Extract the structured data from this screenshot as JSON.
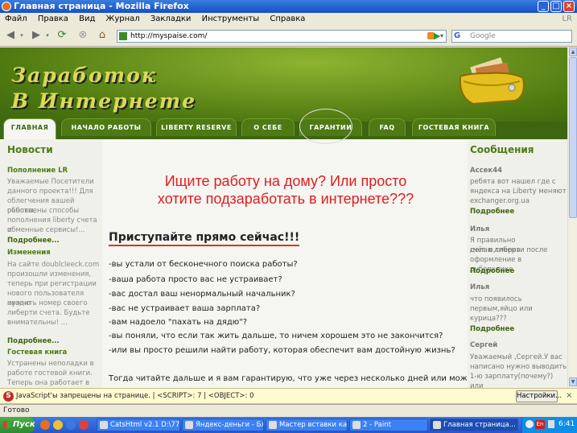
{
  "window": {
    "title": "Главная страница - Mozilla Firefox"
  },
  "menu": [
    "Файл",
    "Правка",
    "Вид",
    "Журнал",
    "Закладки",
    "Инструменты",
    "Справка"
  ],
  "menu_right": "LR",
  "toolbar": {
    "url": "http://myspaise.com/",
    "search_engine": "G",
    "search_placeholder": "Google"
  },
  "site": {
    "logo_line1": "Заработок",
    "logo_line2": "В Интернете",
    "tabs": [
      "ГЛАВНАЯ",
      "НАЧАЛО РАБОТЫ",
      "LIBERTY RESERVE",
      "О СЕБЕ",
      "ГАРАНТИИ",
      "FAQ",
      "ГОСТЕВАЯ КНИГА"
    ],
    "left": {
      "title": "Новости",
      "items": [
        {
          "heading": "Пополнение LR",
          "lines": [
            "Уважаемые Посетители",
            "данного проекта!!! Для",
            "облегчения вашей работы,",
            "обновлены способы",
            "пополнения liberty счета и",
            "обменные сервисы!..."
          ],
          "more": "Подробнее..."
        },
        {
          "heading": "Изменения",
          "lines": [
            "На сайте doublcleeck.com",
            "произошли изменения,",
            "теперь при регистрации",
            "нового пользователя нужно",
            "вводить номер своего",
            "либерти счета. Будьте",
            "внимательны! ..."
          ],
          "more": "Подробнее..."
        },
        {
          "heading": "Гостевая книга",
          "lines": [
            "Устранены неполадки в",
            "работе гостевой книги.",
            "Теперь она работает в"
          ]
        }
      ]
    },
    "main": {
      "headline_1": "Ищите работу на дому? Или просто",
      "headline_2": "хотите подзаработать в интернете???",
      "subheading": "Приступайте прямо сейчас!!!",
      "bullets": [
        "-вы устали от бесконечного поиска работы?",
        "-ваша работа просто вас не устраивает?",
        "-вас достал ваш ненормальный начальник?",
        "-вас не устраивает ваша зарплата?",
        "-вам надоело \"пахать на дядю\"?",
        "-вы поняли, что если так жить дальше, то ничем хорошем это не закончится?",
        "-или вы просто решили найти работу, которая обеспечит вам достойную жизнь?"
      ],
      "closing": "Тогда читайте дальше и я вам гарантирую, что уже через несколько дней или может"
    },
    "right": {
      "title": "Сообщения",
      "items": [
        {
          "name": "Ассек44",
          "lines": [
            "ребята вот нашел где с",
            "яндекса на Liberty меняют",
            "exchanger.org.ua"
          ],
          "more": "Подробнее"
        },
        {
          "name": "Илья",
          "lines": [
            "Я правильно делаю,сперва",
            "счёт в либерти после",
            "оформление в дубопклике."
          ],
          "more": "Подробнее"
        },
        {
          "name": "Илья",
          "lines": [
            "что появилось",
            "первым,яйцо или",
            "курица???"
          ],
          "more": "Подробнее"
        },
        {
          "name": "Сергей",
          "lines": [
            "Уважаемый ,Сергей.У вас",
            "написано нужно выводить",
            "1-ю зарплату(почему?) или"
          ]
        }
      ]
    }
  },
  "notification": {
    "text": "JavaScript'ы запрещены на странице.  | <SCRIPT>: 7 | <OBJECT>: 0",
    "button": "Настройки..."
  },
  "status": "Готово",
  "taskbar": {
    "start": "Пуск",
    "tasks": [
      "CatsHtml v2.1 D:\\777...",
      "Яндекс-деньги - Бл...",
      "Мастер вставки кар...",
      "2 - Paint",
      "Главная страница..."
    ],
    "lang": "En",
    "clock": "6:41"
  },
  "colors": {
    "accent_green": "#4d7a14",
    "headline_red": "#e01e1e",
    "firefox_blue": "#1550c4"
  }
}
